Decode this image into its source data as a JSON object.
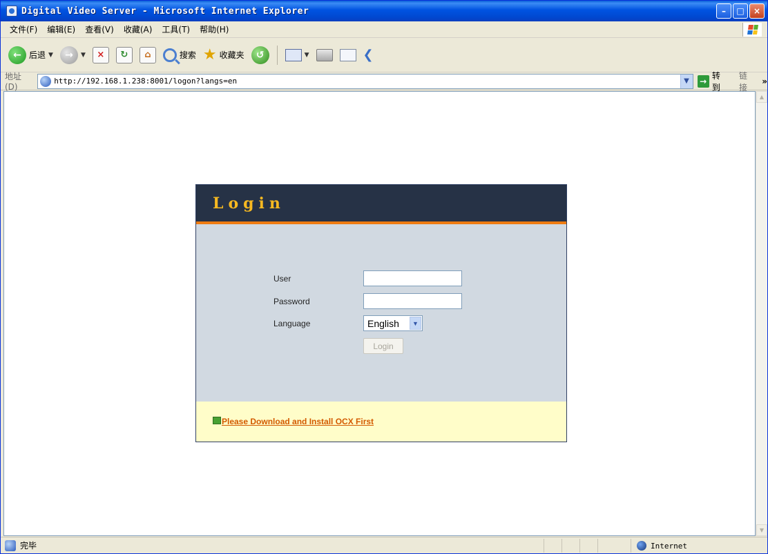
{
  "window": {
    "title": "Digital Video Server - Microsoft Internet Explorer"
  },
  "menu": [
    "文件(F)",
    "编辑(E)",
    "查看(V)",
    "收藏(A)",
    "工具(T)",
    "帮助(H)"
  ],
  "toolbar": {
    "back_label": "后退",
    "search_label": "搜索",
    "favorites_label": "收藏夹"
  },
  "address": {
    "label": "地址(D)",
    "url": "http://192.168.1.238:8001/logon?langs=en",
    "go_label": "转到",
    "links_label": "链接"
  },
  "login": {
    "title": "Login",
    "user_label": "User",
    "password_label": "Password",
    "language_label": "Language",
    "language_value": "English",
    "button_label": "Login",
    "download_link": "Please Download and Install OCX First"
  },
  "status": {
    "text": "完毕",
    "zone": "Internet"
  },
  "colors": {
    "header_bg": "#263246",
    "title_gold": "#f7b921",
    "accent_orange": "#ee7b11",
    "form_bg": "#d1d9e1",
    "footer_bg": "#fffdc9",
    "link": "#d35a00"
  }
}
